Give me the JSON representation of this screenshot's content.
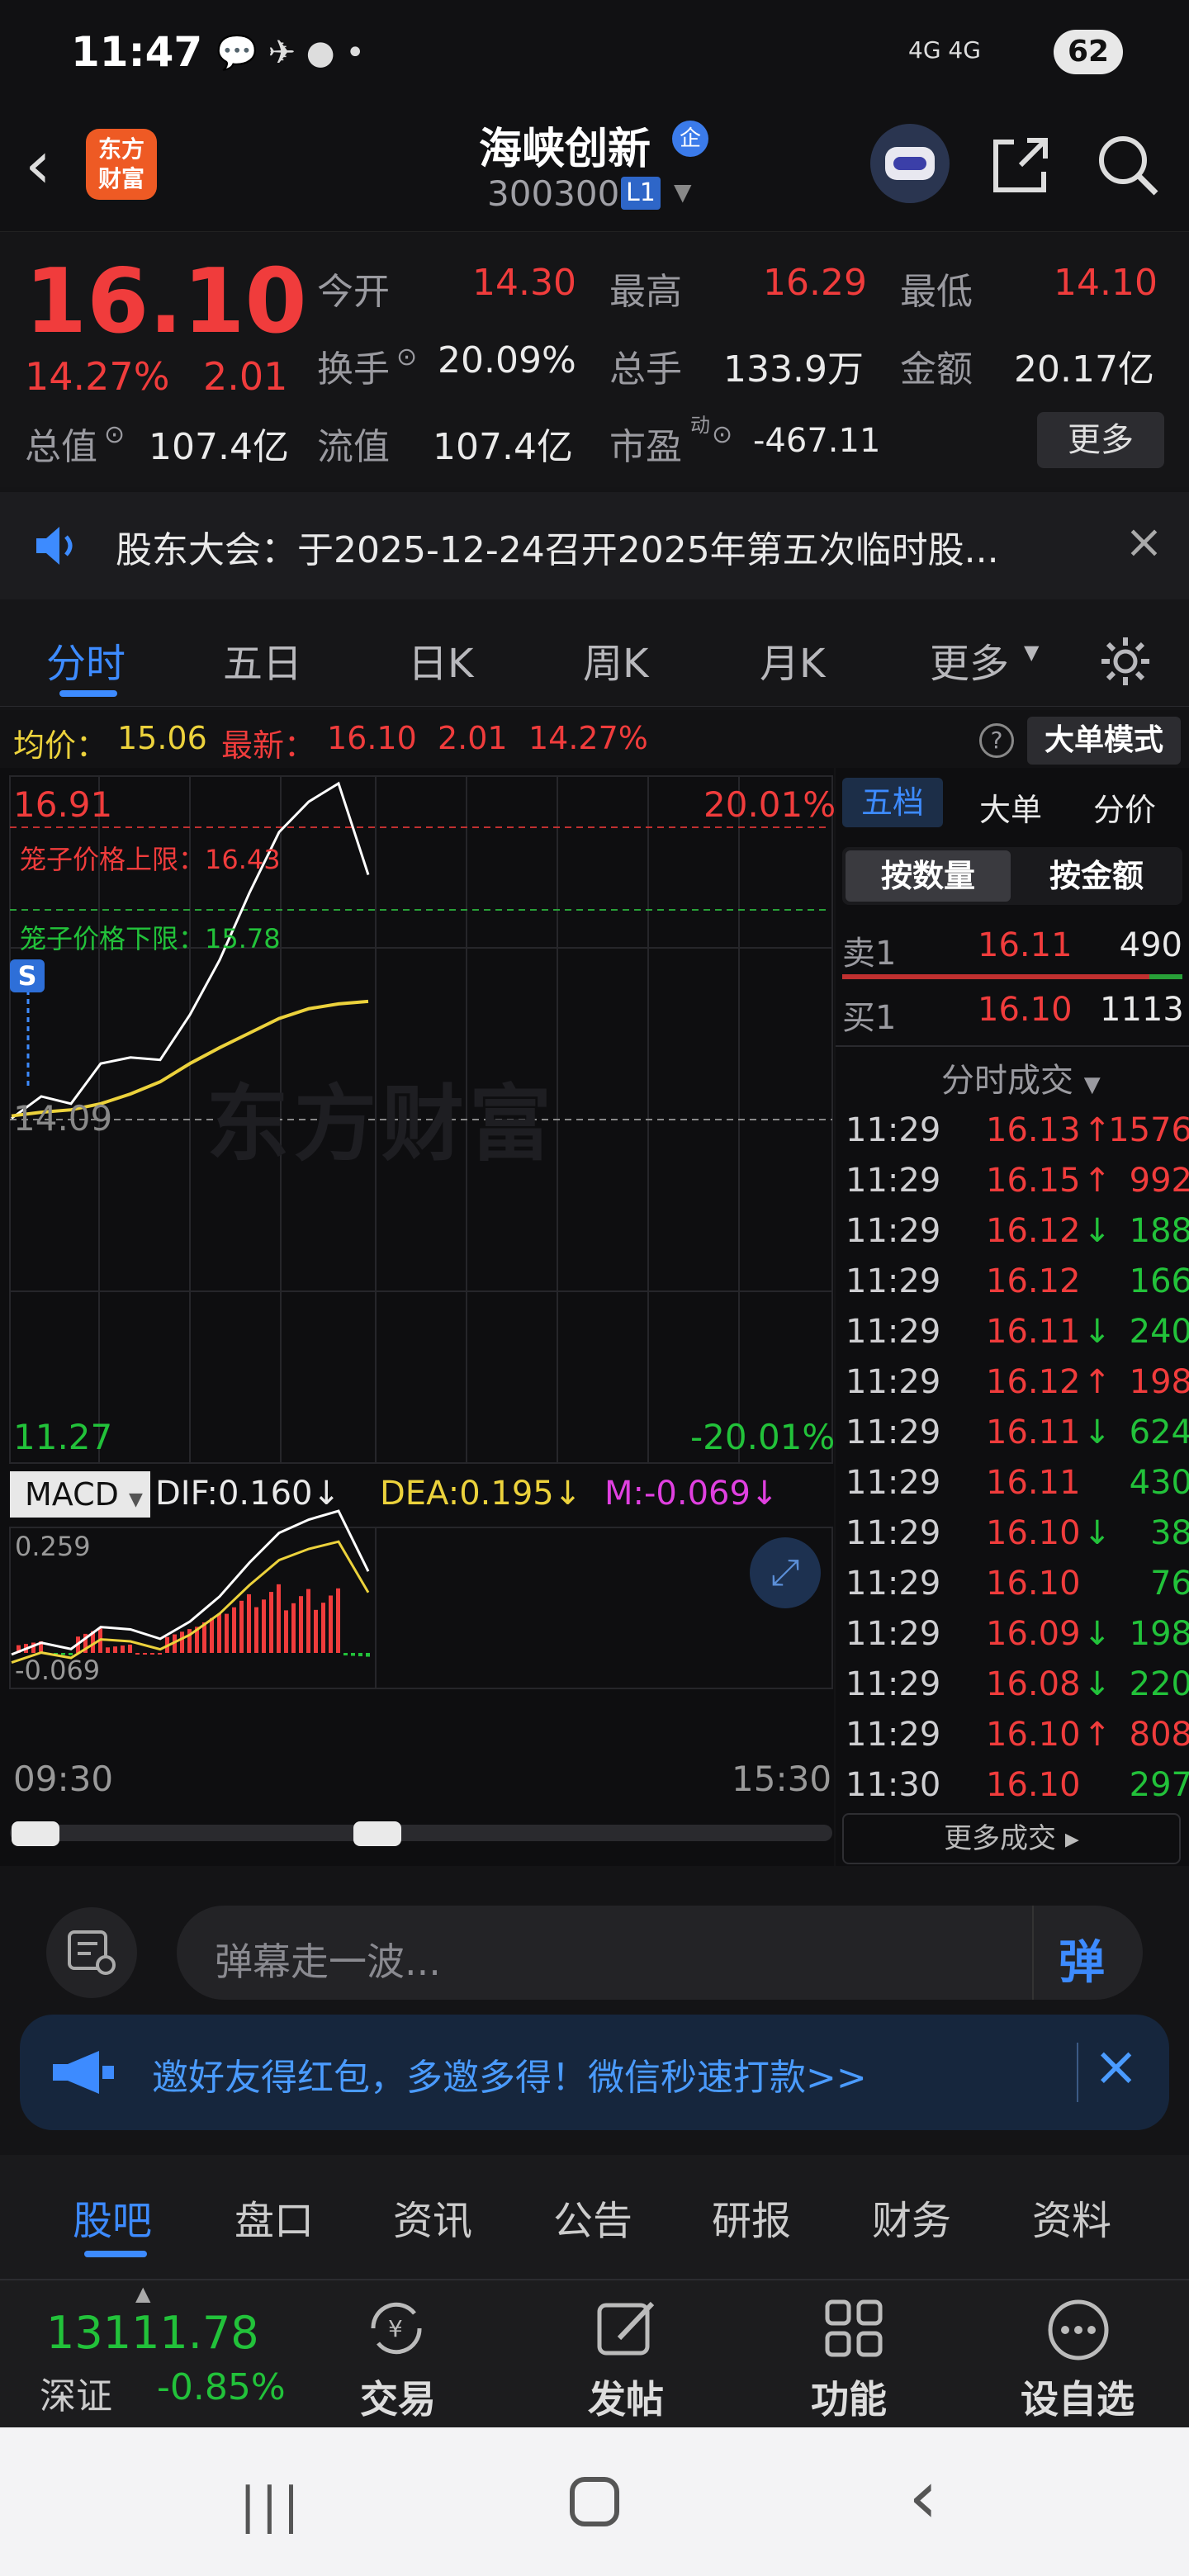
{
  "status_bar": {
    "time": "11:47",
    "battery": "62",
    "network": "4G 4G"
  },
  "header": {
    "logo_line1": "东方",
    "logo_line2": "财富",
    "stock_name": "海峡创新",
    "company_badge": "企",
    "stock_code": "300300",
    "level_badge": "L1"
  },
  "quote": {
    "price": "16.10",
    "change_pct": "14.27%",
    "change": "2.01",
    "open_label": "今开",
    "open": "14.30",
    "high_label": "最高",
    "high": "16.29",
    "low_label": "最低",
    "low": "14.10",
    "turnover_label": "换手",
    "turnover": "20.09%",
    "volume_label": "总手",
    "volume": "133.9万",
    "amount_label": "金额",
    "amount": "20.17亿",
    "total_mv_label": "总值",
    "total_mv": "107.4亿",
    "float_mv_label": "流值",
    "float_mv": "107.4亿",
    "pe_label": "市盈",
    "pe_sup": "动",
    "pe": "-467.11",
    "more_label": "更多"
  },
  "notice": {
    "text": "股东大会：于2025-12-24召开2025年第五次临时股..."
  },
  "chart_tabs": [
    {
      "label": "分时"
    },
    {
      "label": "五日"
    },
    {
      "label": "日K"
    },
    {
      "label": "周K"
    },
    {
      "label": "月K"
    },
    {
      "label": "更多"
    }
  ],
  "info_line": {
    "avg_label": "均价：",
    "avg": "15.06",
    "latest_label": "最新：",
    "latest": "16.10",
    "change": "2.01",
    "change_pct": "14.27%",
    "big_order_button": "大单模式"
  },
  "chart": {
    "y_top": "16.91",
    "y_top_pct": "20.01%",
    "y_mid": "14.09",
    "y_bottom": "11.27",
    "y_bottom_pct": "-20.01%",
    "upper_limit_label": "笼子价格上限：16.43",
    "lower_limit_label": "笼子价格下限：15.78",
    "watermark": "东方财富",
    "s_marker": "S",
    "macd_label": "MACD",
    "dif": "DIF:0.160",
    "dea": "DEA:0.195",
    "m": "M:-0.069",
    "macd_top": "0.259",
    "macd_bottom": "-0.069",
    "time_start": "09:30",
    "time_end": "15:30",
    "colors": {
      "price_line": "#ffffff",
      "avg_line": "#ecd23c",
      "up": "#f03c3c",
      "down": "#22c23a"
    }
  },
  "chart_data": {
    "type": "line",
    "x": [
      "09:30",
      "09:40",
      "09:50",
      "10:00",
      "10:10",
      "10:20",
      "10:30",
      "10:40",
      "10:50",
      "11:00",
      "11:10",
      "11:20",
      "11:30"
    ],
    "series": [
      {
        "values": [
          14.1,
          14.28,
          14.22,
          14.55,
          14.6,
          14.58,
          14.95,
          15.4,
          15.95,
          16.45,
          16.7,
          16.85,
          16.1
        ]
      },
      {
        "values": [
          14.12,
          14.15,
          14.17,
          14.22,
          14.3,
          14.4,
          14.55,
          14.68,
          14.8,
          14.92,
          15.0,
          15.04,
          15.06
        ]
      }
    ],
    "ylim": [
      11.27,
      16.91
    ],
    "annotations": [
      "笼子价格上限：16.43",
      "笼子价格下限：15.78"
    ]
  },
  "panel": {
    "tabs": [
      {
        "label": "五档"
      },
      {
        "label": "大单"
      },
      {
        "label": "分价"
      }
    ],
    "toggle": [
      {
        "label": "按数量"
      },
      {
        "label": "按金额"
      }
    ],
    "sell1_label": "卖1",
    "sell1_price": "16.11",
    "sell1_vol": "490",
    "buy1_label": "买1",
    "buy1_price": "16.10",
    "buy1_vol": "1113",
    "ticks_title": "分时成交",
    "ticks": [
      {
        "time": "11:29",
        "price": "16.13",
        "arrow": "↑",
        "vol": "1576",
        "color": "red"
      },
      {
        "time": "11:29",
        "price": "16.15",
        "arrow": "↑",
        "vol": "992",
        "color": "red"
      },
      {
        "time": "11:29",
        "price": "16.12",
        "arrow": "↓",
        "vol": "188",
        "color": "green"
      },
      {
        "time": "11:29",
        "price": "16.12",
        "arrow": "",
        "vol": "166",
        "color": "green"
      },
      {
        "time": "11:29",
        "price": "16.11",
        "arrow": "↓",
        "vol": "240",
        "color": "green"
      },
      {
        "time": "11:29",
        "price": "16.12",
        "arrow": "↑",
        "vol": "198",
        "color": "red"
      },
      {
        "time": "11:29",
        "price": "16.11",
        "arrow": "↓",
        "vol": "624",
        "color": "green"
      },
      {
        "time": "11:29",
        "price": "16.11",
        "arrow": "",
        "vol": "430",
        "color": "green"
      },
      {
        "time": "11:29",
        "price": "16.10",
        "arrow": "↓",
        "vol": "38",
        "color": "green"
      },
      {
        "time": "11:29",
        "price": "16.10",
        "arrow": "",
        "vol": "76",
        "color": "green"
      },
      {
        "time": "11:29",
        "price": "16.09",
        "arrow": "↓",
        "vol": "198",
        "color": "green"
      },
      {
        "time": "11:29",
        "price": "16.08",
        "arrow": "↓",
        "vol": "220",
        "color": "green"
      },
      {
        "time": "11:29",
        "price": "16.10",
        "arrow": "↑",
        "vol": "808",
        "color": "red"
      },
      {
        "time": "11:30",
        "price": "16.10",
        "arrow": "",
        "vol": "297",
        "color": "green"
      }
    ],
    "more_ticks": "更多成交"
  },
  "chat": {
    "placeholder": "弹幕走一波...",
    "send_label": "弹"
  },
  "invite": {
    "text": "邀好友得红包，多邀多得！微信秒速打款>>"
  },
  "bottom_tabs": [
    {
      "label": "股吧"
    },
    {
      "label": "盘口"
    },
    {
      "label": "资讯"
    },
    {
      "label": "公告"
    },
    {
      "label": "研报"
    },
    {
      "label": "财务"
    },
    {
      "label": "资料"
    }
  ],
  "bottom_nav": {
    "index_value": "13111.78",
    "index_name": "深证",
    "index_change": "-0.85%",
    "trade": "交易",
    "post": "发帖",
    "function": "功能",
    "watchlist": "设自选"
  }
}
